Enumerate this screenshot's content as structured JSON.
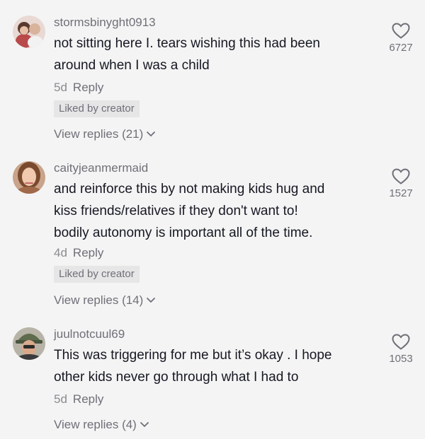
{
  "comments": [
    {
      "username": "stormsbinyght0913",
      "text_lines": [
        "not sitting here I. tears wishing this had been",
        "around when I was a child"
      ],
      "age": "5d",
      "reply_label": "Reply",
      "liked_by_creator": "Liked by creator",
      "view_replies": "View replies (21)",
      "likes": "6727"
    },
    {
      "username": "caityjeanmermaid",
      "text_lines": [
        "and reinforce this by not making kids hug and",
        "kiss friends/relatives if they don't want to!",
        "bodily autonomy is important all of the time."
      ],
      "age": "4d",
      "reply_label": "Reply",
      "liked_by_creator": "Liked by creator",
      "view_replies": "View replies (14)",
      "likes": "1527"
    },
    {
      "username": "juulnotcuul69",
      "text_lines": [
        "This was triggering for me but it’s okay . I hope",
        "other kids never go through what I had to"
      ],
      "age": "5d",
      "reply_label": "Reply",
      "view_replies": "View replies (4)",
      "likes": "1053"
    }
  ],
  "icons": {
    "like": "heart-outline-icon",
    "expand": "chevron-down-icon"
  },
  "colors": {
    "background": "#f4f4f4",
    "text": "#161823",
    "secondary": "#6f7078",
    "badge": "#e6e6e7"
  }
}
